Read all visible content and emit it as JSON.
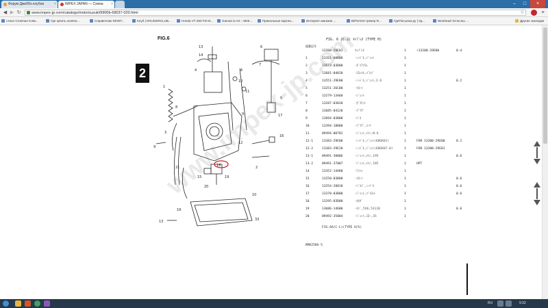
{
  "browser": {
    "tabs": [
      {
        "label": "Форум Джиббо клубов"
      },
      {
        "label": "IMPEX JAPAN — Схема"
      },
      {
        "label": ""
      }
    ],
    "address": "www.impex-jp.com/catalogs/moto/suzuki/9900b-68037-020.html",
    "window_controls": [
      "–",
      "□",
      "×"
    ]
  },
  "bookmarks": [
    "стиол Crosman 5.5м...",
    "Где купить колёси...",
    "Справочник ЮНЕТ...",
    "Клуб | KRUGERCLUB...",
    "Honda VT 250 FD M...",
    "Gamas is Art :: Metr...",
    "Прикольные картин...",
    "Интернет магазин ...",
    "BitTorrent трекер R...",
    "ГдеПосылка.ру | Уд...",
    "Woohead: Если вы ...",
    "Другие закладки"
  ],
  "page": {
    "figure_title": "FIG.6",
    "big_number": "2",
    "table_header": "FIG. 6   (C-2)   ｷｬﾌﾞﾚﾀ   (TYPE H)",
    "column_label": "図番記号",
    "footer": "FIG.6A(C-L)(TYPE H/S)",
    "page_code": "RMX250S-5",
    "watermark": "www.impex-jp.com"
  },
  "diagram": {
    "labels": [
      "13",
      "14",
      "4",
      "6",
      "7",
      "6",
      "10",
      "5",
      "11",
      "1",
      "8",
      "9",
      "17",
      "16",
      "12",
      "3",
      "18",
      "15",
      "20",
      "19",
      "2",
      "13",
      "19",
      "33",
      "10",
      "21",
      "9"
    ]
  },
  "parts": [
    {
      "ref": "",
      "part": "13200-29E01",
      "desc": "ｷｬﾌﾞﾚﾀ",
      "qty": "1",
      "note": "+13200-29E00",
      "year": "0.4"
    },
    {
      "ref": "1",
      "part": "13261-08B00",
      "desc": "･ﾆｰﾄﾞﾙ,ｼﾞｪｯﾄ",
      "qty": "1",
      "note": "",
      "year": ""
    },
    {
      "ref": "2",
      "part": "13573-03D00",
      "desc": "･ﾀﾞｲｱﾌﾗﾑ",
      "qty": "1",
      "note": "",
      "year": ""
    },
    {
      "ref": "3",
      "part": "13681-04010",
      "desc": "･ｽﾛｯﾄﾙ,ﾊﾞﾙﾌﾞ",
      "qty": "1",
      "note": "",
      "year": ""
    },
    {
      "ref": "4",
      "part": "13551-29E00",
      "desc": "･ﾆｰﾄﾞﾙ,ｼﾞｪｯﾄ,3.6",
      "qty": "1",
      "note": "",
      "year": "0.2"
    },
    {
      "ref": "5",
      "part": "13251-26C00",
      "desc": "･ﾌﾛｰﾄ",
      "qty": "1",
      "note": "",
      "year": ""
    },
    {
      "ref": "6",
      "part": "13279-13A60",
      "desc": "･ｼﾞｪｯﾄ",
      "qty": "1",
      "note": "",
      "year": ""
    },
    {
      "ref": "7",
      "part": "13287-03010",
      "desc": "･ｶﾞｽｹｯﾄ",
      "qty": "1",
      "note": "",
      "year": ""
    },
    {
      "ref": "8",
      "part": "13685-04120",
      "desc": "･ﾌﾟﾗｸﾞ",
      "qty": "2",
      "note": "",
      "year": ""
    },
    {
      "ref": "9",
      "part": "13694-03B00",
      "desc": "･ﾊﾞﾈ",
      "qty": "1",
      "note": "",
      "year": ""
    },
    {
      "ref": "10",
      "part": "13394-18000",
      "desc": "･ﾌﾟﾗｸﾞ,ｺｰｸ",
      "qty": "1",
      "note": "",
      "year": ""
    },
    {
      "ref": "11",
      "part": "09494-00782",
      "desc": "･ｼﾞｪｯﾄ,ﾒｲﾝ,N-6",
      "qty": "1",
      "note": "",
      "year": ""
    },
    {
      "ref": "12-1",
      "part": "13383-29E00",
      "desc": "･ﾆｰﾄﾞﾙ,ｼﾞｪｯﾄ(6BGK01)",
      "qty": "1",
      "note": "FOR 13200-29E00",
      "year": "0.2"
    },
    {
      "ref": "12-2",
      "part": "13383-29E20",
      "desc": "･ﾆｰﾄﾞﾙ,ｼﾞｪｯﾄ(6BGK07-8)",
      "qty": "1",
      "note": "FOR 13200-29E01",
      "year": ""
    },
    {
      "ref": "13-1",
      "part": "09491-38006",
      "desc": "･ｼﾞｪｯﾄ,ﾒｲﾝ,195",
      "qty": "1",
      "note": "",
      "year": "0.6"
    },
    {
      "ref": "13-2",
      "part": "09491-37007",
      "desc": "･ｼﾞｪｯﾄ,ﾒｲﾝ,185",
      "qty": "1",
      "note": "OPT",
      "year": ""
    },
    {
      "ref": "14",
      "part": "13352-14A80",
      "desc": "･ﾜｯｼｬ",
      "qty": "1",
      "note": "",
      "year": ""
    },
    {
      "ref": "15",
      "part": "13250-03B00",
      "desc": "･ﾌﾛｰﾄ",
      "qty": "1",
      "note": "",
      "year": "0.6"
    },
    {
      "ref": "16",
      "part": "13254-28010",
      "desc": "･ﾊﾞﾙﾌﾞ,ﾆｰﾄﾞﾙ",
      "qty": "1",
      "note": "",
      "year": "0.6"
    },
    {
      "ref": "17",
      "part": "13370-03B00",
      "desc": "･ｼﾞｪｯﾄ,ﾊﾟｲﾛｯﾄ",
      "qty": "1",
      "note": "",
      "year": "0.6"
    },
    {
      "ref": "18",
      "part": "13295-03D00",
      "desc": "･ﾎﾙﾀﾞ",
      "qty": "1",
      "note": "",
      "year": ""
    },
    {
      "ref": "19",
      "part": "13686-14600",
      "desc": "･ﾈｼﾞ,5X6,53120",
      "qty": "1",
      "note": "",
      "year": "0.6"
    },
    {
      "ref": "20",
      "part": "09492-35004",
      "desc": "･ｼﾞｪｯﾄ,ｽﾛｰ,35",
      "qty": "1",
      "note": "",
      "year": ""
    }
  ],
  "taskbar": {
    "lang": "RU",
    "time": "9:32"
  }
}
